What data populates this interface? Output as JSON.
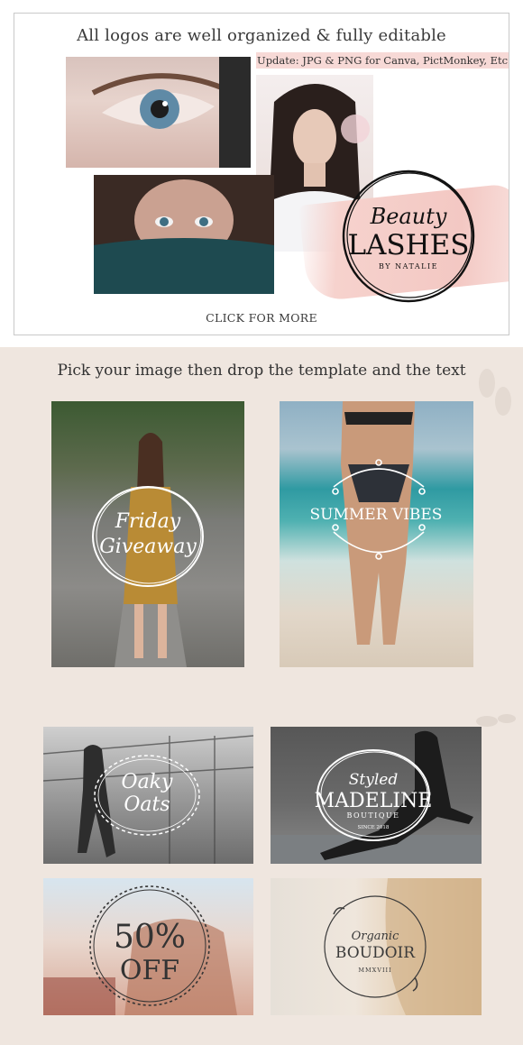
{
  "top": {
    "title": "All logos are well organized & fully editable",
    "update": "Update: JPG & PNG for Canva, PictMonkey, Etc",
    "logo": {
      "line1": "Beauty",
      "line2": "LASHES",
      "line3": "BY NATALIE"
    },
    "click_more": "CLICK FOR MORE"
  },
  "middle": {
    "title": "Pick your image then drop the template and the text",
    "card_friday": {
      "line1": "Friday",
      "line2": "Giveaway"
    },
    "card_summer": {
      "text": "SUMMER VIBES"
    }
  },
  "grid": {
    "oaky": {
      "line1": "Oaky",
      "line2": "Oats"
    },
    "madeline": {
      "line1": "Styled",
      "line2": "MADELINE",
      "line3": "BOUTIQUE",
      "line4": "SINCE 2018"
    },
    "sale": {
      "line1": "50%",
      "line2": "OFF"
    },
    "boudoir": {
      "line1": "Organic",
      "line2": "BOUDOIR",
      "line3": "MMXVIII"
    }
  },
  "colors": {
    "pink_accent": "#f6d2cd",
    "paper_bg": "#efe6df",
    "text_dark": "#333333"
  }
}
